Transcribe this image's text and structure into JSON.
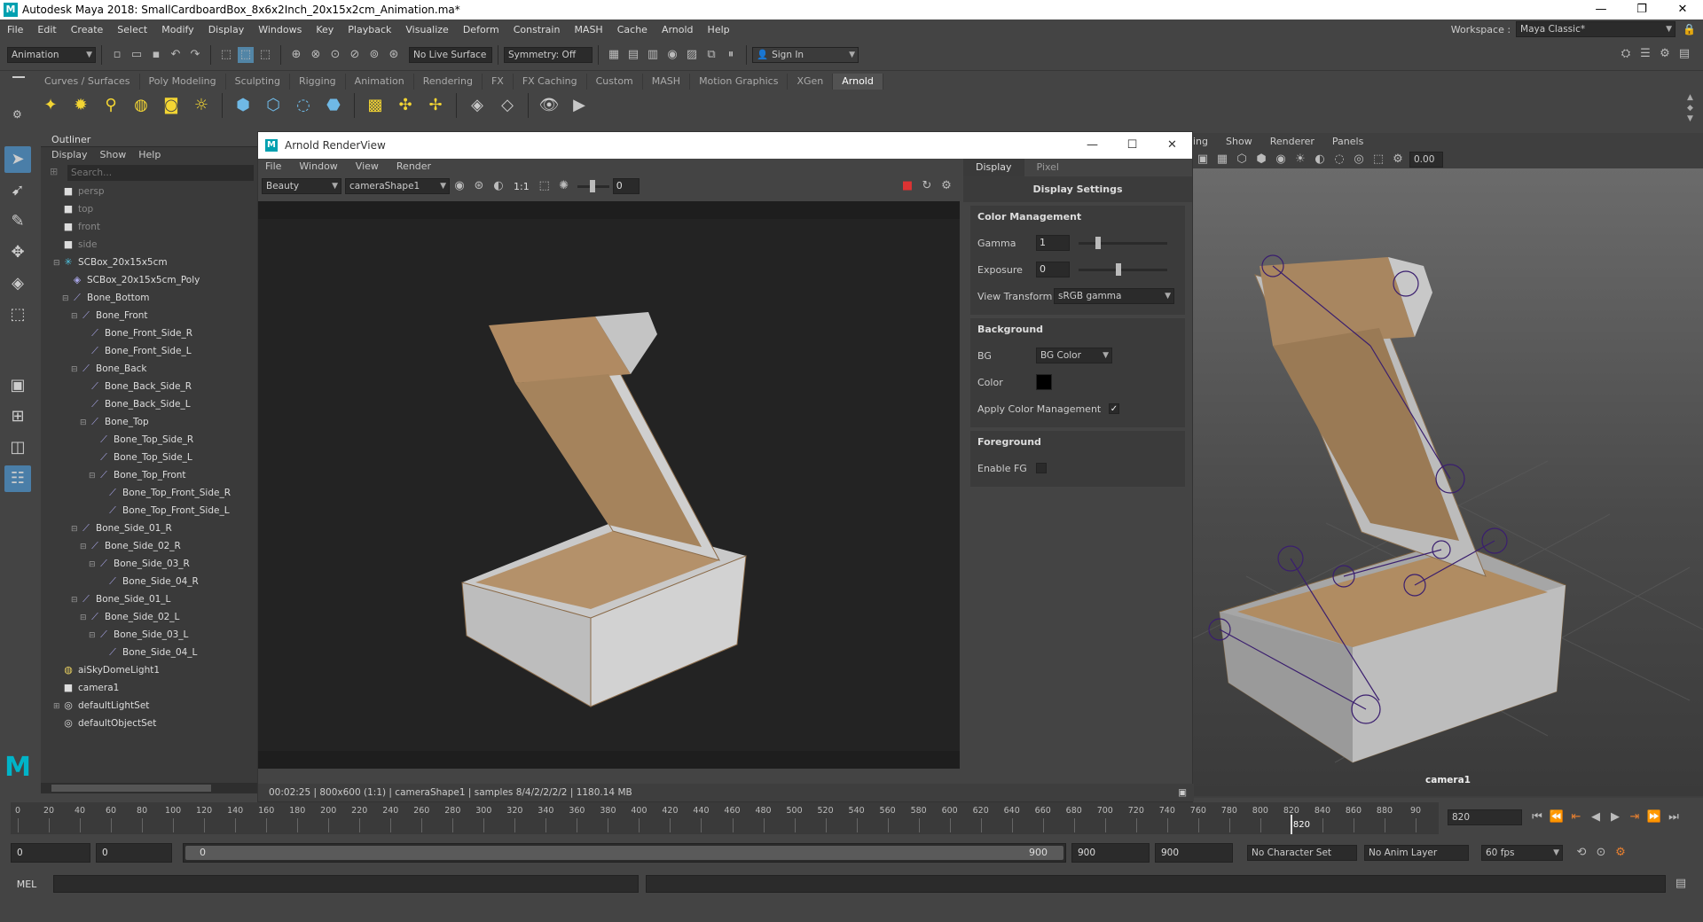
{
  "window": {
    "title": "Autodesk Maya 2018: SmallCardboardBox_8x6x2Inch_20x15x2cm_Animation.ma*",
    "logo": "M",
    "minimize": "—",
    "restore": "❐",
    "close": "✕"
  },
  "menubar": {
    "items": [
      "File",
      "Edit",
      "Create",
      "Select",
      "Modify",
      "Display",
      "Windows",
      "Key",
      "Playback",
      "Visualize",
      "Deform",
      "Constrain",
      "MASH",
      "Cache",
      "Arnold",
      "Help"
    ],
    "workspace_label": "Workspace :",
    "workspace_value": "Maya Classic*"
  },
  "statusline": {
    "mode": "Animation",
    "live_surface": "No Live Surface",
    "symmetry": "Symmetry: Off",
    "sign_in": "Sign In"
  },
  "shelf": {
    "tabs": [
      "Curves / Surfaces",
      "Poly Modeling",
      "Sculpting",
      "Rigging",
      "Animation",
      "Rendering",
      "FX",
      "FX Caching",
      "Custom",
      "MASH",
      "Motion Graphics",
      "XGen",
      "Arnold"
    ],
    "active_tab": "Arnold"
  },
  "outliner": {
    "title": "Outliner",
    "menu": [
      "Display",
      "Show",
      "Help"
    ],
    "search_placeholder": "Search...",
    "items": [
      {
        "label": "persp",
        "depth": 0,
        "icon": "camera-icon",
        "dim": true,
        "exp": ""
      },
      {
        "label": "top",
        "depth": 0,
        "icon": "camera-icon",
        "dim": true,
        "exp": ""
      },
      {
        "label": "front",
        "depth": 0,
        "icon": "camera-icon",
        "dim": true,
        "exp": ""
      },
      {
        "label": "side",
        "depth": 0,
        "icon": "camera-icon",
        "dim": true,
        "exp": ""
      },
      {
        "label": "SCBox_20x15x5cm",
        "depth": 0,
        "icon": "joint-root-icon",
        "dim": false,
        "exp": "⊟"
      },
      {
        "label": "SCBox_20x15x5cm_Poly",
        "depth": 1,
        "icon": "mesh-icon",
        "dim": false,
        "exp": ""
      },
      {
        "label": "Bone_Bottom",
        "depth": 1,
        "icon": "bone-icon",
        "dim": false,
        "exp": "⊟"
      },
      {
        "label": "Bone_Front",
        "depth": 2,
        "icon": "bone-icon",
        "dim": false,
        "exp": "⊟"
      },
      {
        "label": "Bone_Front_Side_R",
        "depth": 3,
        "icon": "bone-icon",
        "dim": false,
        "exp": ""
      },
      {
        "label": "Bone_Front_Side_L",
        "depth": 3,
        "icon": "bone-icon",
        "dim": false,
        "exp": ""
      },
      {
        "label": "Bone_Back",
        "depth": 2,
        "icon": "bone-icon",
        "dim": false,
        "exp": "⊟"
      },
      {
        "label": "Bone_Back_Side_R",
        "depth": 3,
        "icon": "bone-icon",
        "dim": false,
        "exp": ""
      },
      {
        "label": "Bone_Back_Side_L",
        "depth": 3,
        "icon": "bone-icon",
        "dim": false,
        "exp": ""
      },
      {
        "label": "Bone_Top",
        "depth": 3,
        "icon": "bone-icon",
        "dim": false,
        "exp": "⊟"
      },
      {
        "label": "Bone_Top_Side_R",
        "depth": 4,
        "icon": "bone-icon",
        "dim": false,
        "exp": ""
      },
      {
        "label": "Bone_Top_Side_L",
        "depth": 4,
        "icon": "bone-icon",
        "dim": false,
        "exp": ""
      },
      {
        "label": "Bone_Top_Front",
        "depth": 4,
        "icon": "bone-icon",
        "dim": false,
        "exp": "⊟"
      },
      {
        "label": "Bone_Top_Front_Side_R",
        "depth": 5,
        "icon": "bone-icon",
        "dim": false,
        "exp": ""
      },
      {
        "label": "Bone_Top_Front_Side_L",
        "depth": 5,
        "icon": "bone-icon",
        "dim": false,
        "exp": ""
      },
      {
        "label": "Bone_Side_01_R",
        "depth": 2,
        "icon": "bone-icon",
        "dim": false,
        "exp": "⊟"
      },
      {
        "label": "Bone_Side_02_R",
        "depth": 3,
        "icon": "bone-icon",
        "dim": false,
        "exp": "⊟"
      },
      {
        "label": "Bone_Side_03_R",
        "depth": 4,
        "icon": "bone-icon",
        "dim": false,
        "exp": "⊟"
      },
      {
        "label": "Bone_Side_04_R",
        "depth": 5,
        "icon": "bone-icon",
        "dim": false,
        "exp": ""
      },
      {
        "label": "Bone_Side_01_L",
        "depth": 2,
        "icon": "bone-icon",
        "dim": false,
        "exp": "⊟"
      },
      {
        "label": "Bone_Side_02_L",
        "depth": 3,
        "icon": "bone-icon",
        "dim": false,
        "exp": "⊟"
      },
      {
        "label": "Bone_Side_03_L",
        "depth": 4,
        "icon": "bone-icon",
        "dim": false,
        "exp": "⊟"
      },
      {
        "label": "Bone_Side_04_L",
        "depth": 5,
        "icon": "bone-icon",
        "dim": false,
        "exp": ""
      },
      {
        "label": "aiSkyDomeLight1",
        "depth": 0,
        "icon": "skydome-icon",
        "dim": false,
        "exp": ""
      },
      {
        "label": "camera1",
        "depth": 0,
        "icon": "camera-icon",
        "dim": false,
        "exp": ""
      },
      {
        "label": "defaultLightSet",
        "depth": 0,
        "icon": "set-icon",
        "dim": false,
        "exp": "⊞"
      },
      {
        "label": "defaultObjectSet",
        "depth": 0,
        "icon": "set-icon",
        "dim": false,
        "exp": ""
      }
    ]
  },
  "renderview": {
    "title": "Arnold RenderView",
    "menu": [
      "File",
      "Window",
      "View",
      "Render"
    ],
    "aov": "Beauty",
    "camera": "cameraShape1",
    "ratio": "1:1",
    "exposure_value": "0",
    "status": "00:02:25 | 800x600 (1:1) | cameraShape1 | samples 8/4/2/2/2/2 | 1180.14 MB"
  },
  "display_settings": {
    "tabs": [
      "Display",
      "Pixel"
    ],
    "title": "Display Settings",
    "color_mgmt_header": "Color Management",
    "gamma_label": "Gamma",
    "gamma_value": "1",
    "gamma_level": 0.2,
    "exposure_label": "Exposure",
    "exposure_value": "0",
    "exposure_level": 0.45,
    "view_transform_label": "View Transform",
    "view_transform_value": "sRGB gamma",
    "background_header": "Background",
    "bg_label": "BG",
    "bg_value": "BG Color",
    "color_label": "Color",
    "apply_cm_label": "Apply Color Management",
    "apply_cm_checked": "✓",
    "foreground_header": "Foreground",
    "enable_fg_label": "Enable FG"
  },
  "viewport": {
    "menu": [
      "ing",
      "Show",
      "Renderer",
      "Panels"
    ],
    "camera_label": "camera1",
    "value_field": "0.00"
  },
  "timeline": {
    "ticks": [
      "0",
      "20",
      "40",
      "60",
      "80",
      "100",
      "120",
      "140",
      "160",
      "180",
      "200",
      "220",
      "240",
      "260",
      "280",
      "300",
      "320",
      "340",
      "360",
      "380",
      "400",
      "420",
      "440",
      "460",
      "480",
      "500",
      "520",
      "540",
      "560",
      "580",
      "600",
      "620",
      "640",
      "660",
      "680",
      "700",
      "720",
      "740",
      "760",
      "780",
      "800",
      "820",
      "840",
      "860",
      "880",
      "90"
    ],
    "current_frame": "820",
    "current_field": "820"
  },
  "range": {
    "start": "0",
    "anim_start": "0",
    "slider_start": "0",
    "slider_end": "900",
    "anim_end": "900",
    "end": "900",
    "character_set": "No Character Set",
    "anim_layer": "No Anim Layer",
    "fps": "60 fps"
  },
  "cmdline": {
    "label": "MEL"
  }
}
